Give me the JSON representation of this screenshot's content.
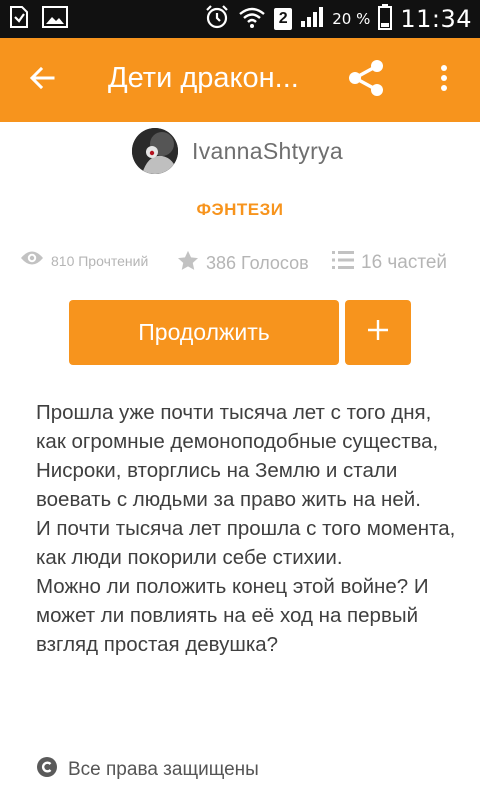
{
  "status_bar": {
    "sim_slot": "2",
    "battery": "20 %",
    "clock": "11:34"
  },
  "app_bar": {
    "title": "Дети дракон...",
    "back_icon": "arrow-left-icon",
    "share_icon": "share-icon",
    "menu_icon": "more-vertical-icon"
  },
  "author": {
    "name": "IvannaShtyrya"
  },
  "genre": "ФЭНТЕЗИ",
  "stats": {
    "reads": "810 Прочтений",
    "votes": "386 Голосов",
    "parts": "16 частей"
  },
  "actions": {
    "continue_label": "Продолжить",
    "add_label": "+"
  },
  "description": [
    "Прошла уже почти тысяча лет с того дня, как огромные демоноподобные существа, Нисроки, вторглись на Землю и стали воевать с людьми за право жить на ней.",
    "И почти тысяча лет прошла с того момента, как люди покорили себе стихии.",
    "Можно ли положить конец этой войне? И может ли повлиять на её ход на первый взгляд простая девушка?"
  ],
  "copyright": "Все права защищены",
  "colors": {
    "accent": "#f7941d",
    "status_bar": "#111111",
    "muted": "#b5b5b5",
    "body_text": "#3f3f3f"
  }
}
